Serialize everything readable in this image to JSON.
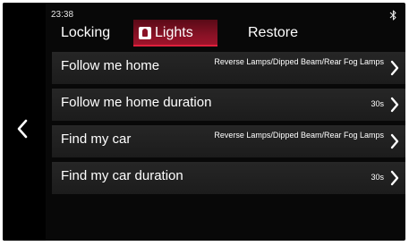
{
  "status": {
    "time": "23:38",
    "bluetooth_icon": "bluetooth-icon"
  },
  "tabs": [
    {
      "label": "Locking",
      "selected": false
    },
    {
      "label": "Lights",
      "selected": true,
      "icon": "lamp-icon"
    },
    {
      "label": "Restore",
      "selected": false
    }
  ],
  "settings": [
    {
      "label": "Follow me home",
      "value": "Reverse Lamps/Dipped Beam/Rear Fog Lamps"
    },
    {
      "label": "Follow me home duration",
      "value": "30s"
    },
    {
      "label": "Find my car",
      "value": "Reverse Lamps/Dipped Beam/Rear Fog Lamps"
    },
    {
      "label": "Find my car duration",
      "value": "30s"
    }
  ],
  "colors": {
    "background": "#080808",
    "accent": "#a3142c",
    "row": "#222222",
    "text": "#ffffff"
  },
  "nav": {
    "back_icon": "chevron-left-icon"
  }
}
